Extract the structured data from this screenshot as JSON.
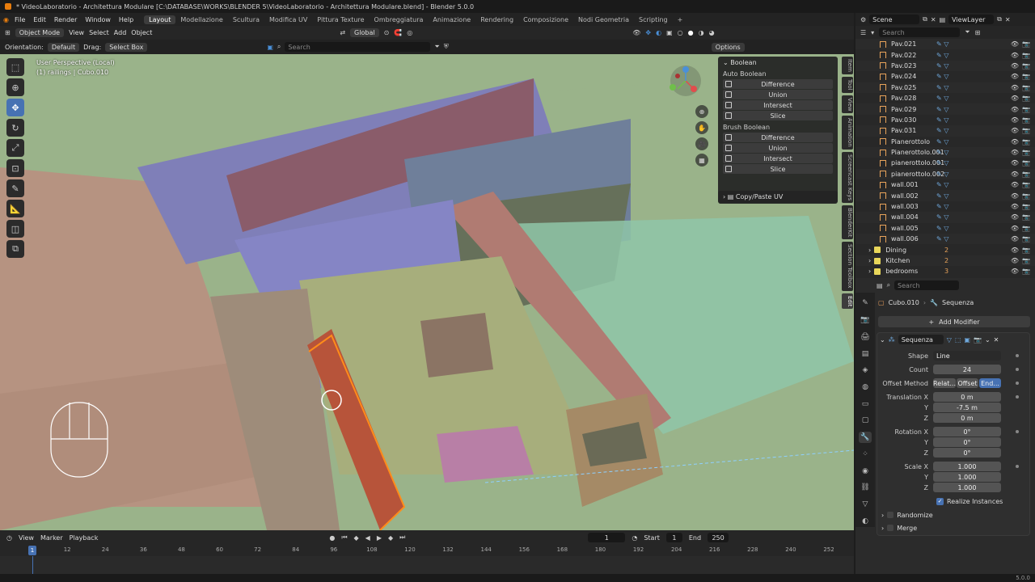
{
  "window": {
    "title": "* VideoLaboratorio - Architettura Modulare [C:\\DATABASE\\WORKS\\BLENDER 5\\VideoLaboratorio - Architettura Modulare.blend] - Blender 5.0.0"
  },
  "menu": {
    "items": [
      "File",
      "Edit",
      "Render",
      "Window",
      "Help"
    ]
  },
  "workspaces": {
    "items": [
      "Layout",
      "Modellazione",
      "Scultura",
      "Modifica UV",
      "Pittura Texture",
      "Ombreggiatura",
      "Animazione",
      "Rendering",
      "Composizione",
      "Nodi Geometria",
      "Scripting"
    ],
    "active": "Layout",
    "add": "+"
  },
  "topright": {
    "scene": "Scene",
    "view_layer": "ViewLayer"
  },
  "viewport_header": {
    "mode": "Object Mode",
    "view": "View",
    "select": "Select",
    "add": "Add",
    "object": "Object",
    "transform": "Global"
  },
  "tool_header": {
    "orientation_label": "Orientation:",
    "orientation": "Default",
    "drag_label": "Drag:",
    "drag": "Select Box",
    "search_placeholder": "Search",
    "options": "Options"
  },
  "viewport_info": {
    "line1": "User Perspective (Local)",
    "line2": "(1) railings | Cubo.010"
  },
  "npanel": {
    "title": "Boolean",
    "auto_label": "Auto Boolean",
    "auto": [
      "Difference",
      "Union",
      "Intersect",
      "Slice"
    ],
    "brush_label": "Brush Boolean",
    "brush": [
      "Difference",
      "Union",
      "Intersect",
      "Slice"
    ],
    "copy_uv": "Copy/Paste UV"
  },
  "ntabs": [
    "Item",
    "Tool",
    "View",
    "Animation",
    "Screencast Keys",
    "BlenderKit",
    "Section Toolbox",
    "Edit"
  ],
  "ntab_active": "Edit",
  "outliner": {
    "search_placeholder": "Search",
    "rows": [
      "Pav.021",
      "Pav.022",
      "Pav.023",
      "Pav.024",
      "Pav.025",
      "Pav.028",
      "Pav.029",
      "Pav.030",
      "Pav.031",
      "Pianerottolo",
      "Pianerottolo.001",
      "pianerottolo.001",
      "pianerottolo.002",
      "wall.001",
      "wall.002",
      "wall.003",
      "wall.004",
      "wall.005",
      "wall.006"
    ],
    "collections": [
      "Dining",
      "Kitchen",
      "bedrooms"
    ],
    "collection_counts": [
      "2",
      "2",
      "3"
    ]
  },
  "properties": {
    "search_placeholder": "Search",
    "object": "Cubo.010",
    "modifier_name": "Sequenza",
    "add_modifier": "Add Modifier",
    "shape_label": "Shape",
    "shape": "Line",
    "count_label": "Count",
    "count": "24",
    "offset_label": "Offset Method",
    "offset_opts": [
      "Relat...",
      "Offset",
      "End..."
    ],
    "translation_label": "Translation X",
    "tx": "0 m",
    "ty": "-7.5 m",
    "tz": "0 m",
    "rotation_label": "Rotation X",
    "rx": "0°",
    "ry": "0°",
    "rz": "0°",
    "scale_label": "Scale X",
    "sx": "1.000",
    "sy": "1.000",
    "sz": "1.000",
    "y_label": "Y",
    "z_label": "Z",
    "realize": "Realize Instances",
    "randomize": "Randomize",
    "merge": "Merge"
  },
  "timeline": {
    "view": "View",
    "marker": "Marker",
    "playback": "Playback",
    "current_frame": "1",
    "start_label": "Start",
    "start": "1",
    "end_label": "End",
    "end": "250",
    "ticks": [
      "1",
      "12",
      "24",
      "36",
      "48",
      "60",
      "72",
      "84",
      "96",
      "108",
      "120",
      "132",
      "144",
      "156",
      "168",
      "180",
      "192",
      "204",
      "216",
      "228",
      "240",
      "252"
    ]
  },
  "status": {
    "version": "5.0.0"
  },
  "colors": {
    "accent": "#4772b3",
    "blender_orange": "#e87d0d",
    "ground": "#9ab38a",
    "selected_outline": "#ff8c1a"
  }
}
